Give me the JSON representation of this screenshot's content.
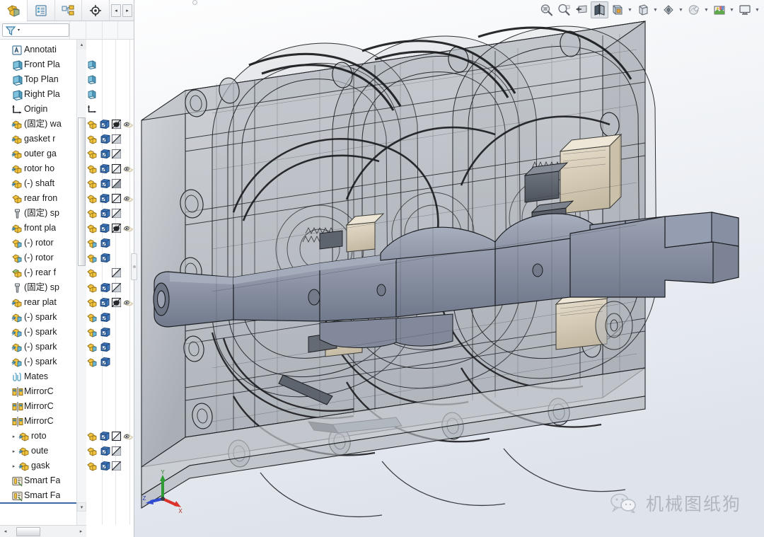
{
  "app": {
    "name": "SOLIDWORKS",
    "document_type": "assembly"
  },
  "feature_manager": {
    "tabs": [
      {
        "id": "feature-tree",
        "label": "FeatureManager Design Tree",
        "icon": "yellow-cube-icon",
        "active": true
      },
      {
        "id": "property-manager",
        "label": "PropertyManager",
        "icon": "property-list-icon",
        "active": false
      },
      {
        "id": "configuration-manager",
        "label": "ConfigurationManager",
        "icon": "configuration-icon",
        "active": false
      },
      {
        "id": "dimxpert-manager",
        "label": "DimXpertManager",
        "icon": "target-crosshair-icon",
        "active": false
      }
    ],
    "nav_prev_label": "◂",
    "nav_next_label": "▸",
    "filter": {
      "placeholder": "",
      "value": "",
      "icon": "filter-funnel-icon",
      "caret": "▾"
    },
    "columns": [
      {
        "id": "component",
        "header": ""
      },
      {
        "id": "display-state",
        "header": ""
      },
      {
        "id": "appearance",
        "header": ""
      },
      {
        "id": "visibility",
        "header": ""
      }
    ],
    "tree": [
      {
        "label": "Annotati",
        "icon": "annotations-icon",
        "indent": 0,
        "twist": "",
        "cols": []
      },
      {
        "label": "Front Pla",
        "icon": "plane-icon",
        "indent": 0,
        "twist": "",
        "cols": [
          "plane"
        ]
      },
      {
        "label": "Top Plan",
        "icon": "plane-icon",
        "indent": 0,
        "twist": "",
        "cols": [
          "plane"
        ]
      },
      {
        "label": "Right Pla",
        "icon": "plane-icon",
        "indent": 0,
        "twist": "",
        "cols": [
          "plane"
        ]
      },
      {
        "label": "Origin",
        "icon": "origin-icon",
        "indent": 0,
        "twist": "",
        "cols": [
          "origin"
        ]
      },
      {
        "label": "(固定) wa",
        "icon": "component-mate-icon",
        "indent": 0,
        "twist": "",
        "cols": [
          "comp",
          "display",
          "shade-dark",
          "eye"
        ]
      },
      {
        "label": "gasket r",
        "icon": "component-mate-icon",
        "indent": 0,
        "twist": "",
        "cols": [
          "comp",
          "display",
          "shade-light",
          ""
        ]
      },
      {
        "label": "outer ga",
        "icon": "component-mate-icon",
        "indent": 0,
        "twist": "",
        "cols": [
          "comp",
          "display",
          "shade-light",
          ""
        ]
      },
      {
        "label": "rotor ho",
        "icon": "component-mate-icon",
        "indent": 0,
        "twist": "",
        "cols": [
          "comp",
          "display",
          "shade-pale",
          "eye"
        ]
      },
      {
        "label": "(-) shaft",
        "icon": "component-mate-icon",
        "indent": 0,
        "twist": "",
        "cols": [
          "comp",
          "display",
          "shade-mid",
          ""
        ]
      },
      {
        "label": "rear fron",
        "icon": "component-icon",
        "indent": 0,
        "twist": "",
        "cols": [
          "comp",
          "display",
          "shade-pale",
          "eye"
        ]
      },
      {
        "label": "(固定) sp",
        "icon": "bolt-icon",
        "indent": 0,
        "twist": "",
        "cols": [
          "comp",
          "display",
          "shade-light",
          ""
        ]
      },
      {
        "label": "front pla",
        "icon": "component-mate-icon",
        "indent": 0,
        "twist": "",
        "cols": [
          "comp",
          "display",
          "shade-dark",
          "eye"
        ]
      },
      {
        "label": "(-) rotor",
        "icon": "component-blue-icon",
        "indent": 0,
        "twist": "",
        "cols": [
          "comp-blue",
          "display",
          "",
          ""
        ]
      },
      {
        "label": "(-) rotor",
        "icon": "component-blue-icon",
        "indent": 0,
        "twist": "",
        "cols": [
          "comp-blue",
          "display",
          "",
          ""
        ]
      },
      {
        "label": "(-) rear f",
        "icon": "component-green-icon",
        "indent": 0,
        "twist": "",
        "cols": [
          "comp",
          "",
          "shade-light",
          ""
        ]
      },
      {
        "label": "(固定) sp",
        "icon": "bolt-icon",
        "indent": 0,
        "twist": "",
        "cols": [
          "comp",
          "display",
          "shade-light",
          ""
        ]
      },
      {
        "label": "rear plat",
        "icon": "component-mate-icon",
        "indent": 0,
        "twist": "",
        "cols": [
          "comp",
          "display",
          "shade-dark",
          "eye"
        ]
      },
      {
        "label": "(-) spark",
        "icon": "component-mate-blue-icon",
        "indent": 0,
        "twist": "",
        "cols": [
          "comp-blue",
          "display",
          "",
          ""
        ]
      },
      {
        "label": "(-) spark",
        "icon": "component-mate-blue-icon",
        "indent": 0,
        "twist": "",
        "cols": [
          "comp-blue",
          "display",
          "",
          ""
        ]
      },
      {
        "label": "(-) spark",
        "icon": "component-mate-blue-icon",
        "indent": 0,
        "twist": "",
        "cols": [
          "comp-blue",
          "display",
          "",
          ""
        ]
      },
      {
        "label": "(-) spark",
        "icon": "component-mate-blue-icon",
        "indent": 0,
        "twist": "",
        "cols": [
          "comp-blue",
          "display",
          "",
          ""
        ]
      },
      {
        "label": "Mates",
        "icon": "mates-paperclip-icon",
        "indent": 0,
        "twist": "",
        "cols": []
      },
      {
        "label": "MirrorC",
        "icon": "mirror-components-icon",
        "indent": 0,
        "twist": "",
        "cols": []
      },
      {
        "label": "MirrorC",
        "icon": "mirror-components-icon",
        "indent": 0,
        "twist": "",
        "cols": []
      },
      {
        "label": "MirrorC",
        "icon": "mirror-components-icon",
        "indent": 0,
        "twist": "",
        "cols": []
      },
      {
        "label": "roto",
        "icon": "component-mate-icon",
        "indent": 1,
        "twist": "▸",
        "cols": [
          "comp",
          "display",
          "shade-pale",
          "eye"
        ]
      },
      {
        "label": "oute",
        "icon": "component-mate-icon",
        "indent": 1,
        "twist": "▸",
        "cols": [
          "comp",
          "display",
          "shade-light",
          ""
        ]
      },
      {
        "label": "gask",
        "icon": "component-mate-icon",
        "indent": 1,
        "twist": "▸",
        "cols": [
          "comp",
          "display",
          "shade-light",
          ""
        ]
      },
      {
        "label": "Smart Fa",
        "icon": "smart-fasteners-icon",
        "indent": 0,
        "twist": "",
        "cols": []
      },
      {
        "label": "Smart Fa",
        "icon": "smart-fasteners-icon",
        "indent": 0,
        "twist": "",
        "cols": []
      }
    ],
    "hscroll": {
      "left_arrow": "◂",
      "right_arrow": "▸"
    },
    "vscroll": {
      "up_arrow": "▴",
      "down_arrow": "▾"
    }
  },
  "view_toolbar": {
    "buttons": [
      {
        "id": "zoom-to-fit",
        "label": "Zoom to Fit",
        "icon": "zoom-to-fit-icon",
        "caret": false,
        "active": false
      },
      {
        "id": "zoom-to-area",
        "label": "Zoom to Area",
        "icon": "zoom-to-area-icon",
        "caret": false,
        "active": false
      },
      {
        "id": "previous-view",
        "label": "Previous View",
        "icon": "previous-view-icon",
        "caret": false,
        "active": false
      },
      {
        "id": "section-view",
        "label": "Section View",
        "icon": "section-view-icon",
        "caret": false,
        "active": true
      },
      {
        "id": "view-orientation",
        "label": "View Orientation",
        "icon": "view-orientation-icon",
        "caret": false,
        "active": false
      },
      {
        "id": "display-style",
        "label": "Display Style",
        "icon": "display-style-icon",
        "caret": true,
        "active": false
      },
      {
        "id": "hide-show-items",
        "label": "Hide/Show Items",
        "icon": "hide-show-eyeglasses-icon",
        "caret": true,
        "active": false
      },
      {
        "id": "edit-appearance",
        "label": "Edit Appearance",
        "icon": "edit-appearance-sphere-icon",
        "caret": true,
        "active": false
      },
      {
        "id": "apply-scene",
        "label": "Apply Scene",
        "icon": "apply-scene-icon",
        "caret": true,
        "active": false
      },
      {
        "id": "view-settings",
        "label": "View Settings",
        "icon": "view-settings-monitor-icon",
        "caret": true,
        "active": false
      }
    ]
  },
  "viewport": {
    "triad": {
      "x_label": "X",
      "y_label": "Y",
      "z_label": "Z",
      "x_color": "#d9332b",
      "y_color": "#2f9c33",
      "z_color": "#2f4bd0"
    },
    "model_description": "Sectioned rotary (Wankel) engine assembly shown with transparent housing and eccentric shaft",
    "colors": {
      "shaft": "#8b93a4",
      "housing_transparent": "#b3b8bf",
      "housing_edge": "#2b2d31",
      "tan_part": "#d9cfbb",
      "background_top": "#ffffff",
      "background_bottom": "#e2e7ee"
    }
  },
  "watermark": {
    "text": "机械图纸狗",
    "icon": "wechat-logo-icon"
  }
}
